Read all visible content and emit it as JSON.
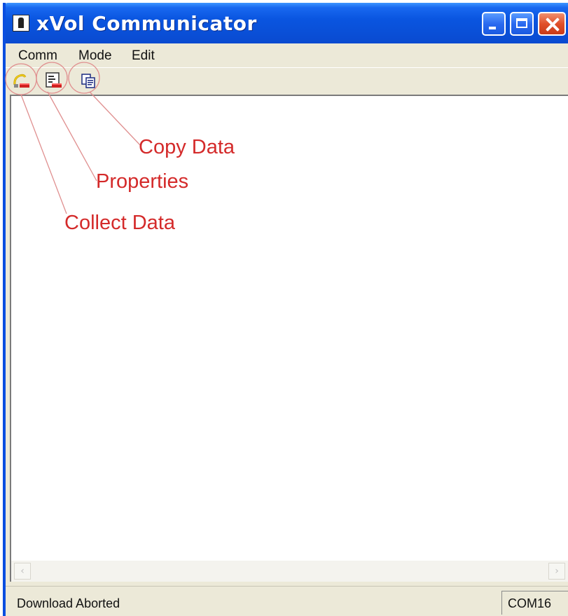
{
  "window": {
    "title": "xVol Communicator",
    "title_bar_color": "#0a55e0",
    "close_button_color": "#e0502a"
  },
  "title_bar_buttons": {
    "minimize_icon": "minimize-icon",
    "maximize_icon": "maximize-icon",
    "close_icon": "close-icon"
  },
  "menu": {
    "items": [
      {
        "label": "Comm"
      },
      {
        "label": "Mode"
      },
      {
        "label": "Edit"
      }
    ]
  },
  "toolbar": {
    "buttons": [
      {
        "icon": "collect-data-icon"
      },
      {
        "icon": "properties-icon"
      },
      {
        "icon": "copy-data-icon"
      }
    ]
  },
  "annotations": {
    "color": "#d42a2a",
    "copy_data": "Copy Data",
    "properties": "Properties",
    "collect_data": "Collect Data"
  },
  "status_bar": {
    "message": "Download Aborted",
    "port": "COM16"
  }
}
